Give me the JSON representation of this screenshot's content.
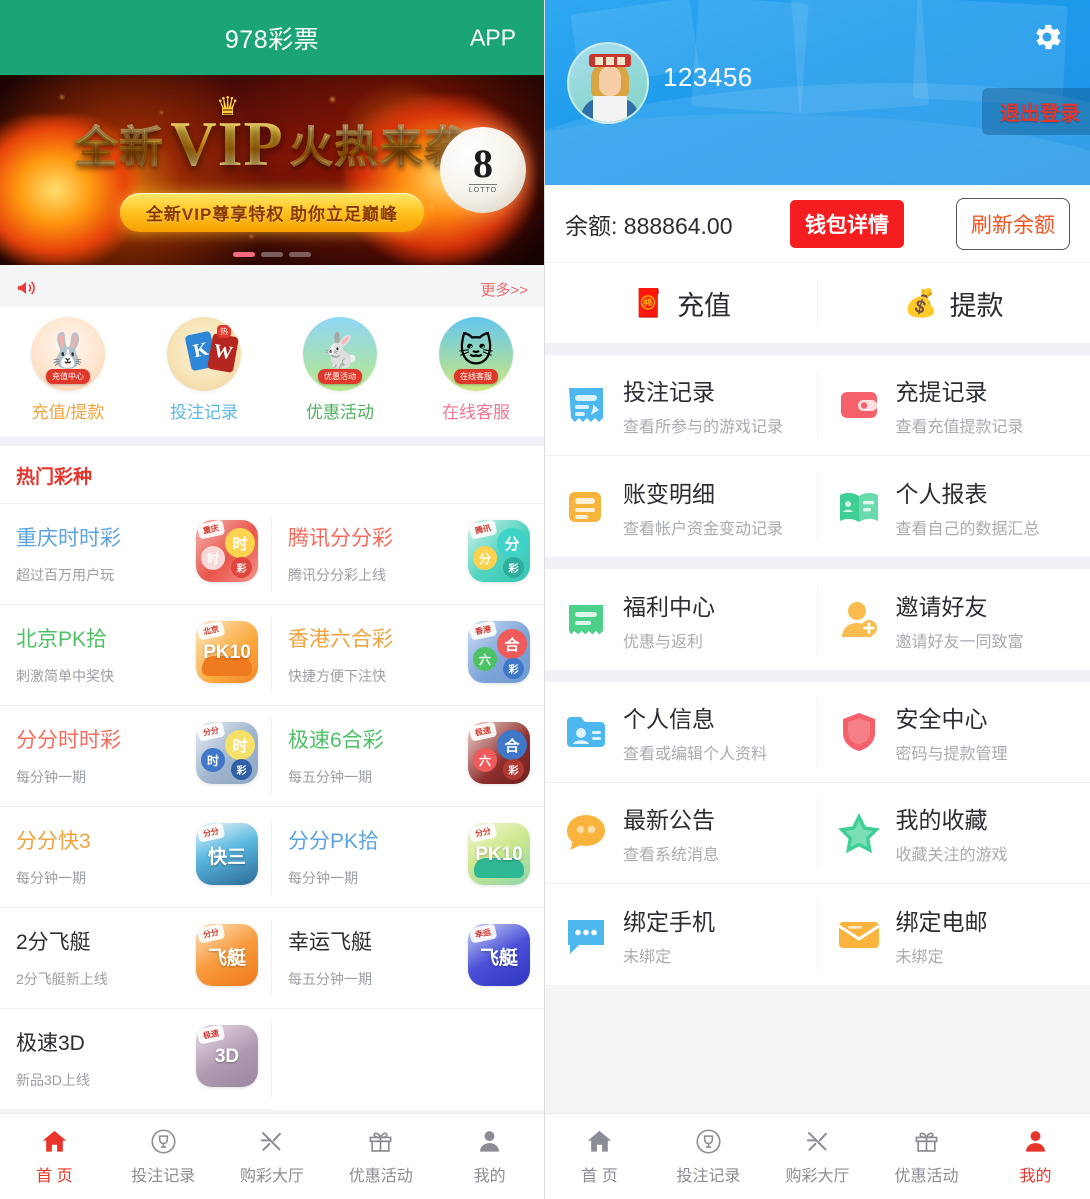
{
  "left": {
    "header": {
      "title": "978彩票",
      "app_label": "APP"
    },
    "banner": {
      "headline_1": "全新",
      "headline_vip": "VIP",
      "headline_2": "火热来袭",
      "subtitle": "全新VIP尊享特权  助你立足巅峰",
      "ball_number": "8",
      "ball_caption": "LOTTO"
    },
    "notice": {
      "icon": "horn-icon",
      "more_label": "更多>>"
    },
    "quick_items": [
      {
        "label": "充值/提款",
        "color": "#f0a33c",
        "tag": "充值中心",
        "icon": "rabbit-recharge-icon"
      },
      {
        "label": "投注记录",
        "color": "#5bb8e8",
        "tag": "",
        "icon": "kw-cards-icon"
      },
      {
        "label": "优惠活动",
        "color": "#4faf5d",
        "tag": "优惠活动",
        "icon": "rabbit-promo-icon"
      },
      {
        "label": "在线客服",
        "color": "#f07890",
        "tag": "在线客服",
        "icon": "lucky-cat-icon"
      }
    ],
    "hot_section_title": "热门彩种",
    "lotteries": [
      {
        "name": "重庆时时彩",
        "desc": "超过百万用户玩",
        "color": "#5ba4e0",
        "ribbon": "重庆",
        "b1": "时",
        "b2": "时",
        "b3": "彩",
        "bg": "linear-gradient(135deg,#f6b7b2 0%,#e8564c 55%,#f2938c 100%)",
        "c1": "#ffd34d",
        "c2": "#f6d9d6",
        "c3": "#e0473c",
        "icon": "lottery-ball-icon"
      },
      {
        "name": "腾讯分分彩",
        "desc": "腾讯分分彩上线",
        "color": "#f96a5a",
        "ribbon": "腾讯",
        "b1": "分",
        "b2": "分",
        "b3": "彩",
        "bg": "linear-gradient(135deg,#d5f2e8 0%,#4fd3c0 55%,#35c6b4 100%)",
        "c1": "#3fd3c8",
        "c2": "#ffd24d",
        "c3": "#2fae9e",
        "icon": "lottery-ball-icon"
      },
      {
        "name": "北京PK拾",
        "desc": "刺激简单中奖快",
        "color": "#4cc264",
        "ribbon": "北京",
        "big": "PK10",
        "car": "#f07a1e",
        "bg": "linear-gradient(135deg,#ffe9c2 0%,#f9a93c 60%,#f5862a 100%)",
        "icon": "pk10-car-icon"
      },
      {
        "name": "香港六合彩",
        "desc": "快捷方便下注快",
        "color": "#f0a33c",
        "ribbon": "香港",
        "b1": "合",
        "b2": "六",
        "b3": "彩",
        "bg": "linear-gradient(135deg,#cfe0f7 0%,#7ea4d8 55%,#6f9ad4 100%)",
        "c1": "#ef5a5a",
        "c2": "#4cc264",
        "c3": "#3f78c8",
        "icon": "lottery-ball-icon"
      },
      {
        "name": "分分时时彩",
        "desc": "每分钟一期",
        "color": "#f96a5a",
        "ribbon": "分分",
        "b1": "时",
        "b2": "时",
        "b3": "彩",
        "bg": "linear-gradient(135deg,#e8eef6 0%,#9fb4cd 55%,#8ea7c4 100%)",
        "c1": "#f5e06a",
        "c2": "#3f78c8",
        "c3": "#2f5fa8",
        "icon": "lottery-ball-icon"
      },
      {
        "name": "极速6合彩",
        "desc": "每五分钟一期",
        "color": "#4cc264",
        "ribbon": "极速",
        "b1": "合",
        "b2": "六",
        "b3": "彩",
        "bg": "linear-gradient(135deg,#f3d7d4 0%,#8c2e2c 60%,#6e1f1e 100%)",
        "c1": "#3f78c8",
        "c2": "#ef5a5a",
        "c3": "#b03a33",
        "icon": "lottery-ball-icon"
      },
      {
        "name": "分分快3",
        "desc": "每分钟一期",
        "color": "#f0a33c",
        "ribbon": "分分",
        "big": "快三",
        "bg": "linear-gradient(160deg,#eaf6fc 0%,#5ab8e0 45%,#2b6b96 100%)",
        "icon": "kuai3-icon"
      },
      {
        "name": "分分PK拾",
        "desc": "每分钟一期",
        "color": "#5ba4e0",
        "ribbon": "分分",
        "big": "PK10",
        "car": "#2fb894",
        "bg": "linear-gradient(150deg,#f3f7d8 0%,#cfe88e 45%,#8fd6a8 100%)",
        "icon": "pk10-car-icon"
      },
      {
        "name": "2分飞艇",
        "desc": "2分飞艇新上线",
        "color": "#2a2d33",
        "ribbon": "分分",
        "big": "飞艇",
        "bg": "linear-gradient(150deg,#fde3c2 0%,#f79a3c 50%,#ef7a1c 100%)",
        "icon": "airship-icon"
      },
      {
        "name": "幸运飞艇",
        "desc": "每五分钟一期",
        "color": "#2a2d33",
        "ribbon": "幸运",
        "big": "飞艇",
        "bg": "linear-gradient(150deg,#cdd8f5 0%,#4a50d8 50%,#2f35bf 100%)",
        "icon": "airship-icon"
      },
      {
        "name": "极速3D",
        "desc": "新品3D上线",
        "color": "#2a2d33",
        "ribbon": "极速",
        "big": "3D",
        "bg": "linear-gradient(150deg,#e8dce8 0%,#b09ab0 55%,#9a86a0 100%)",
        "icon": "d3-icon"
      }
    ]
  },
  "right": {
    "profile": {
      "username": "123456",
      "logout_label": "退出登录",
      "gear_icon": "gear-icon",
      "avatar_icon": "avatar-icon"
    },
    "balance": {
      "text": "余额: 888864.00",
      "wallet_label": "钱包详情",
      "refresh_label": "刷新余额"
    },
    "deposit_withdraw": [
      {
        "label": "充值",
        "icon": "money-envelope-icon"
      },
      {
        "label": "提款",
        "icon": "money-bag-icon"
      }
    ],
    "menu_groups": [
      [
        {
          "title": "投注记录",
          "sub": "查看所参与的游戏记录",
          "icon": "bet-record-icon",
          "color": "#4db8ef"
        },
        {
          "title": "充提记录",
          "sub": "查看充值提款记录",
          "icon": "transaction-record-icon",
          "color": "#f4616b"
        },
        {
          "title": "账变明细",
          "sub": "查看帐户资金变动记录",
          "icon": "account-detail-icon",
          "color": "#f6b43c"
        },
        {
          "title": "个人报表",
          "sub": "查看自己的数据汇总",
          "icon": "report-icon",
          "color": "#3ecf95"
        }
      ],
      [
        {
          "title": "福利中心",
          "sub": "优惠与返利",
          "icon": "welfare-icon",
          "color": "#4cd08a"
        },
        {
          "title": "邀请好友",
          "sub": "邀请好友一同致富",
          "icon": "invite-friend-icon",
          "color": "#f8bd4e"
        }
      ],
      [
        {
          "title": "个人信息",
          "sub": "查看或编辑个人资料",
          "icon": "personal-info-icon",
          "color": "#4db8ef"
        },
        {
          "title": "安全中心",
          "sub": "密码与提款管理",
          "icon": "security-shield-icon",
          "color": "#f4616b"
        },
        {
          "title": "最新公告",
          "sub": "查看系统消息",
          "icon": "announcement-icon",
          "color": "#f8b43c"
        },
        {
          "title": "我的收藏",
          "sub": "收藏关注的游戏",
          "icon": "favorite-star-icon",
          "color": "#3ecf95"
        },
        {
          "title": "绑定手机",
          "sub": "未绑定",
          "icon": "bind-phone-icon",
          "color": "#4db8ef"
        },
        {
          "title": "绑定电邮",
          "sub": "未绑定",
          "icon": "bind-email-icon",
          "color": "#f8b43c"
        }
      ]
    ]
  },
  "tabbar": {
    "items": [
      {
        "label": "首 页",
        "icon": "home-icon"
      },
      {
        "label": "投注记录",
        "icon": "trophy-icon"
      },
      {
        "label": "购彩大厅",
        "icon": "scissors-icon"
      },
      {
        "label": "优惠活动",
        "icon": "gift-icon"
      },
      {
        "label": "我的",
        "icon": "user-icon"
      }
    ],
    "left_active_index": 0,
    "right_active_index": 4,
    "active_color": "#e8352c",
    "inactive_color": "#8a8d94"
  }
}
